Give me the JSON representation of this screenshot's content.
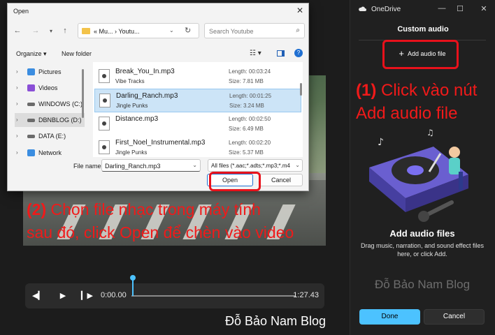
{
  "right_panel": {
    "app_title": "OneDrive",
    "header": "Custom audio",
    "add_audio_button": "Add audio file",
    "empty_title": "Add audio files",
    "empty_description": "Drag music, narration, and sound effect files here, or click Add.",
    "watermark": "Đỗ Bảo Nam Blog",
    "done_button": "Done",
    "cancel_button": "Cancel"
  },
  "annotations": {
    "step1_number": "(1)",
    "step1_line1": "Click vào nút",
    "step1_line2": "Add audio file",
    "step2_number": "(2)",
    "step2_line1": "Chọn file nhạc trong máy tính",
    "step2_line2": "sau đó, click Open để chèn vào video",
    "highlight_color": "#e8111b"
  },
  "player": {
    "current_time": "0:00.00",
    "duration": "1:27.43",
    "progress": 0
  },
  "bottom_watermark": "Đỗ Bảo Nam Blog",
  "dialog": {
    "title": "Open",
    "address_path": "« Mu... › Youtu...",
    "search_placeholder": "Search Youtube",
    "organize": "Organize ▾",
    "new_folder": "New folder",
    "nav_items": [
      {
        "label": "Pictures",
        "icon": "pictures-folder-icon",
        "color": "#3b8de0"
      },
      {
        "label": "Videos",
        "icon": "videos-folder-icon",
        "color": "#8a4fd6"
      },
      {
        "label": "WINDOWS (C:)",
        "icon": "drive-icon",
        "color": "#6b6b6b"
      },
      {
        "label": "DBNBLOG (D:)",
        "icon": "drive-icon",
        "color": "#6b6b6b"
      },
      {
        "label": "DATA (E:)",
        "icon": "drive-icon",
        "color": "#6b6b6b"
      },
      {
        "label": "Network",
        "icon": "network-icon",
        "color": "#3b8de0"
      }
    ],
    "files": [
      {
        "name": "Break_You_In.mp3",
        "artist": "Vibe Tracks",
        "length": "Length: 00:03:24",
        "size": "Size: 7.81 MB"
      },
      {
        "name": "Darling_Ranch.mp3",
        "artist": "Jingle Punks",
        "length": "Length: 00:01:25",
        "size": "Size: 3.24 MB"
      },
      {
        "name": "Distance.mp3",
        "artist": "",
        "length": "Length: 00:02:50",
        "size": "Size: 6.49 MB"
      },
      {
        "name": "First_Noel_Instrumental.mp3",
        "artist": "Jingle Punks",
        "length": "Length: 00:02:20",
        "size": "Size: 5.37 MB"
      }
    ],
    "selected_file_index": 1,
    "file_name_label": "File name:",
    "file_name_value": "Darling_Ranch.mp3",
    "file_type_filter": "All files (*.aac;*.adts;*.mp3;*.m4",
    "open_button": "Open",
    "cancel_button": "Cancel"
  }
}
